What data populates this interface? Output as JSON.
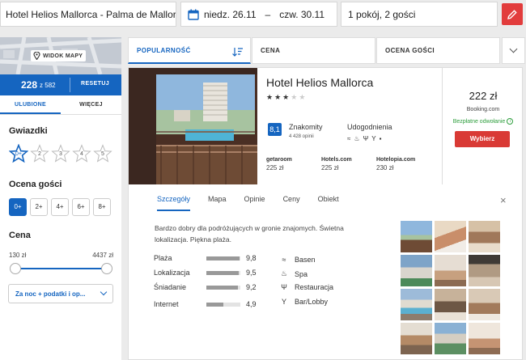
{
  "search": {
    "destination": "Hotel Helios Mallorca - Palma de Mallorca",
    "checkin": "niedz. 26.11",
    "dash": "–",
    "checkout": "czw. 30.11",
    "rooms": "1 pokój, 2 gości"
  },
  "sidebar": {
    "map_button": "WIDOK MAPY",
    "count": "228",
    "count_total": "z 582",
    "reset": "RESETUJ",
    "tabs": [
      "ULUBIONE",
      "WIĘCEJ"
    ],
    "stars_title": "Gwiazdki",
    "stars": [
      "0+",
      "2",
      "3",
      "4",
      "5"
    ],
    "rating_title": "Ocena gości",
    "ratings": [
      "0+",
      "2+",
      "4+",
      "6+",
      "8+"
    ],
    "price_title": "Cena",
    "price_min": "130 zł",
    "price_max": "4437 zł",
    "price_mode": "Za noc + podatki i op..."
  },
  "sort": {
    "popularity": "POPULARNOŚĆ",
    "price": "CENA",
    "rating": "OCENA GOŚCI"
  },
  "hotel": {
    "name": "Hotel Helios Mallorca",
    "stars": 3,
    "score": "8,1",
    "score_text": "Znakomity",
    "reviews": "4 428 opinii",
    "amenities_title": "Udogodnienia",
    "providers": [
      {
        "name": "getaroom",
        "price": "225 zł"
      },
      {
        "name": "Hotels.com",
        "price": "225 zł"
      },
      {
        "name": "Hotelopia.com",
        "price": "230 zł"
      }
    ],
    "price": "222 zł",
    "price_source": "Booking.com",
    "free_cancel": "Bezpłatne odwołanie",
    "choose": "Wybierz"
  },
  "details": {
    "tabs": [
      "Szczegóły",
      "Mapa",
      "Opinie",
      "Ceny",
      "Obiekt"
    ],
    "close": "×",
    "description": "Bardzo dobry dla podróżujących w gronie znajomych. Świetna lokalizacja. Piękna plaża.",
    "ratings": [
      {
        "label": "Plaża",
        "value": "9,8",
        "fill": 0.98
      },
      {
        "label": "Lokalizacja",
        "value": "9,5",
        "fill": 0.95
      },
      {
        "label": "Śniadanie",
        "value": "9,2",
        "fill": 0.92
      },
      {
        "label": "Internet",
        "value": "4,9",
        "fill": 0.49
      }
    ],
    "amenities": [
      {
        "icon": "swimmer-icon",
        "label": "Basen"
      },
      {
        "icon": "spa-icon",
        "label": "Spa"
      },
      {
        "icon": "restaurant-icon",
        "label": "Restauracja"
      },
      {
        "icon": "cocktail-icon",
        "label": "Bar/Lobby"
      }
    ]
  },
  "colors": {
    "accent": "#1565c0",
    "cta": "#d93a35",
    "edit": "#e23c3c",
    "free": "#2e9e3d"
  }
}
